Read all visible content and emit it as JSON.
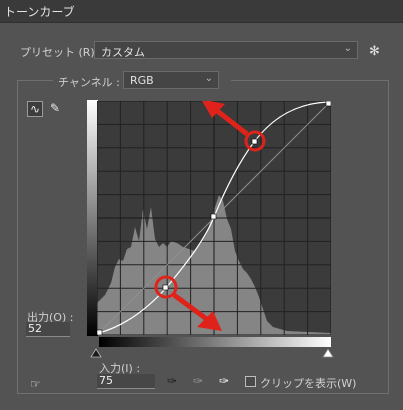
{
  "window": {
    "title": "トーンカーブ"
  },
  "preset": {
    "label": "プリセット (R) :",
    "value": "カスタム"
  },
  "channel": {
    "label": "チャンネル :",
    "value": "RGB"
  },
  "output": {
    "label": "出力(O) :",
    "value": "52"
  },
  "input": {
    "label": "入力(I) :",
    "value": "75"
  },
  "clip": {
    "label": "クリップを表示(W)",
    "checked": false
  },
  "icons": {
    "settings": "gear-icon",
    "curve_tool": "curve-tool-icon",
    "pencil_tool": "pencil-icon",
    "chevron": "chevron-down-icon",
    "eyedropper": "eyedropper-icon",
    "hand": "on-image-adjust-icon"
  },
  "colors": {
    "annotation_red": "#e0231a",
    "curve": "#ffffff"
  }
}
